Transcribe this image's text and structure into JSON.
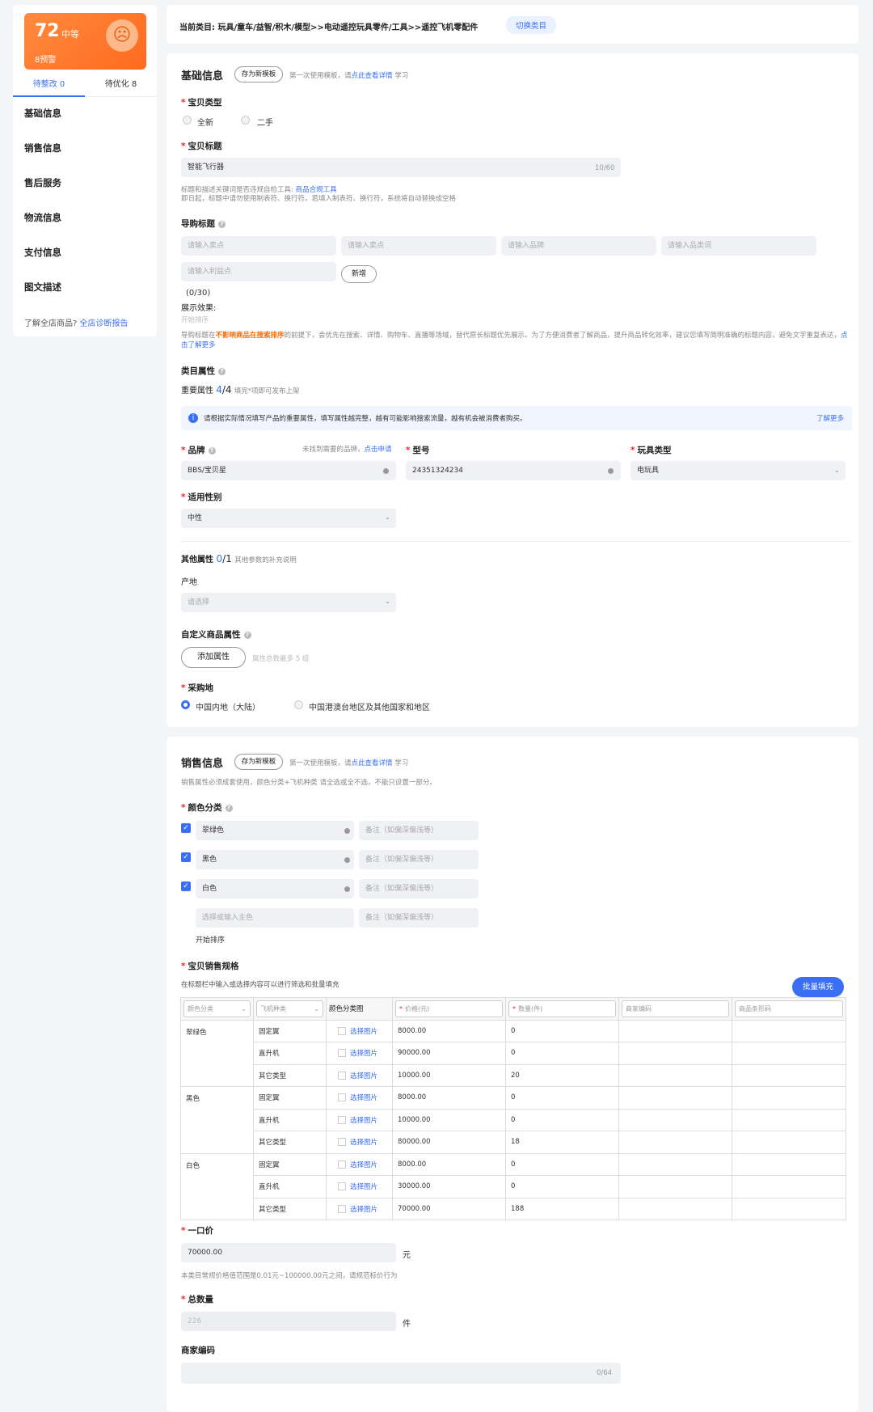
{
  "sidebar": {
    "score": "72",
    "level": "中等",
    "warnings": "8预警",
    "face": "☹",
    "tabs": [
      "待整改 0",
      "待优化 8"
    ],
    "items": [
      "基础信息",
      "销售信息",
      "售后服务",
      "物流信息",
      "支付信息",
      "图文描述"
    ],
    "foot_text": "了解全店商品?",
    "foot_link": "全店诊断报告"
  },
  "category": {
    "label": "当前类目: 玩具/童车/益智/积木/模型>>电动遥控玩具零件/工具>>遥控飞机零配件",
    "switch_btn": "切换类目"
  },
  "basic": {
    "title": "基础信息",
    "save_template": "存为新模板",
    "tpl_hint": "第一次使用模板，请",
    "tpl_link": "点此查看详情",
    "tpl_hint2": "学习",
    "type_label": "宝贝类型",
    "type_options": [
      "全新",
      "二手"
    ],
    "title_label": "宝贝标题",
    "title_value": "智能飞行器",
    "title_count": "10/60",
    "title_hint1": "标题和描述关键词是否违规自检工具:",
    "title_hint_link": "商品合规工具",
    "title_hint2": "即日起，标题中请勿使用制表符、换行符。若填入制表符、换行符，系统将自动替换成空格",
    "guide_label": "导购标题",
    "guide_ph": [
      "请输入卖点",
      "请输入卖点",
      "请输入品牌",
      "请输入品类词",
      "请输入利益点"
    ],
    "add_btn": "新增",
    "guide_count": "(0/30)",
    "effect_label": "展示效果:",
    "effect_ph": "开始排序",
    "guide_hint_a": "导购标题在",
    "guide_hint_b": "不影响商品在搜索排序",
    "guide_hint_c": "的前提下，会优先在搜索、详情、购物车、直播等场域，替代原长标题优先展示。为了方便消费者了解商品，提升商品转化效率，建议您填写简明准确的标题内容，避免文字重复",
    "guide_hint_d": "表达，",
    "guide_hint_link": "点击了解更多",
    "attr_label": "类目属性",
    "imp_label": "重要属性",
    "imp_a": "4",
    "imp_b": "/4",
    "imp_hint": "填完*项即可发布上架",
    "notice": "请根据实际情况填写产品的重要属性，填写属性越完整，越有可能影响搜索流量，越有机会被消费者购买。",
    "notice_link": "了解更多",
    "brand_label": "品牌",
    "brand_hint": "未找到需要的品牌，",
    "brand_link": "点击申请",
    "brand_value": "BBS/宝贝星",
    "model_label": "型号",
    "model_value": "24351324234",
    "toy_label": "玩具类型",
    "toy_value": "电玩具",
    "gender_label": "适用性别",
    "gender_value": "中性",
    "other_label": "其他属性",
    "other_a": "0",
    "other_b": "/1",
    "other_hint": "其他参数的补充说明",
    "origin_label": "产地",
    "origin_ph": "请选择",
    "custom_label": "自定义商品属性",
    "custom_btn": "添加属性",
    "custom_hint": "属性总数最多 5 组",
    "purchase_label": "采购地",
    "purchase_options": [
      "中国内地（大陆）",
      "中国港澳台地区及其他国家和地区"
    ]
  },
  "sales": {
    "title": "销售信息",
    "save_template": "存为新模板",
    "tpl_hint": "第一次使用模板，请",
    "tpl_link": "点此查看详情",
    "tpl_hint2": "学习",
    "sales_hint": "销售属性必须成套使用，颜色分类+飞机种类 请全选或全不选，不能只设置一部分。",
    "color_label": "颜色分类",
    "colors": [
      "翠绿色",
      "黑色",
      "白色"
    ],
    "color_input_ph": "选择或输入主色",
    "note_ph": "备注（如偏深偏浅等）",
    "sort_label": "开始排序",
    "spec_label": "宝贝销售规格",
    "spec_hint": "在标题栏中输入或选择内容可以进行筛选和批量填充",
    "batch_btn": "批量填充",
    "headers": [
      "颜色分类",
      "飞机种类",
      "颜色分类图",
      "价格(元)",
      "数量(件)",
      "商家编码",
      "商品条形码"
    ],
    "choose_pic": "选择图片",
    "groups": [
      {
        "color": "翠绿色",
        "rows": [
          [
            "固定翼",
            "8000.00",
            "0"
          ],
          [
            "直升机",
            "90000.00",
            "0"
          ],
          [
            "其它类型",
            "10000.00",
            "20"
          ]
        ]
      },
      {
        "color": "黑色",
        "rows": [
          [
            "固定翼",
            "8000.00",
            "0"
          ],
          [
            "直升机",
            "10000.00",
            "0"
          ],
          [
            "其它类型",
            "80000.00",
            "18"
          ]
        ]
      },
      {
        "color": "白色",
        "rows": [
          [
            "固定翼",
            "8000.00",
            "0"
          ],
          [
            "直升机",
            "30000.00",
            "0"
          ],
          [
            "其它类型",
            "70000.00",
            "188"
          ]
        ]
      }
    ],
    "price_label": "一口价",
    "price_value": "70000.00",
    "price_unit": "元",
    "price_hint": "本类目常规价格值范围是0.01元~100000.00元之间，请规范标价行为",
    "qty_label": "总数量",
    "qty_value": "226",
    "qty_unit": "件",
    "code_label": "商家编码",
    "code_count": "0/64"
  }
}
